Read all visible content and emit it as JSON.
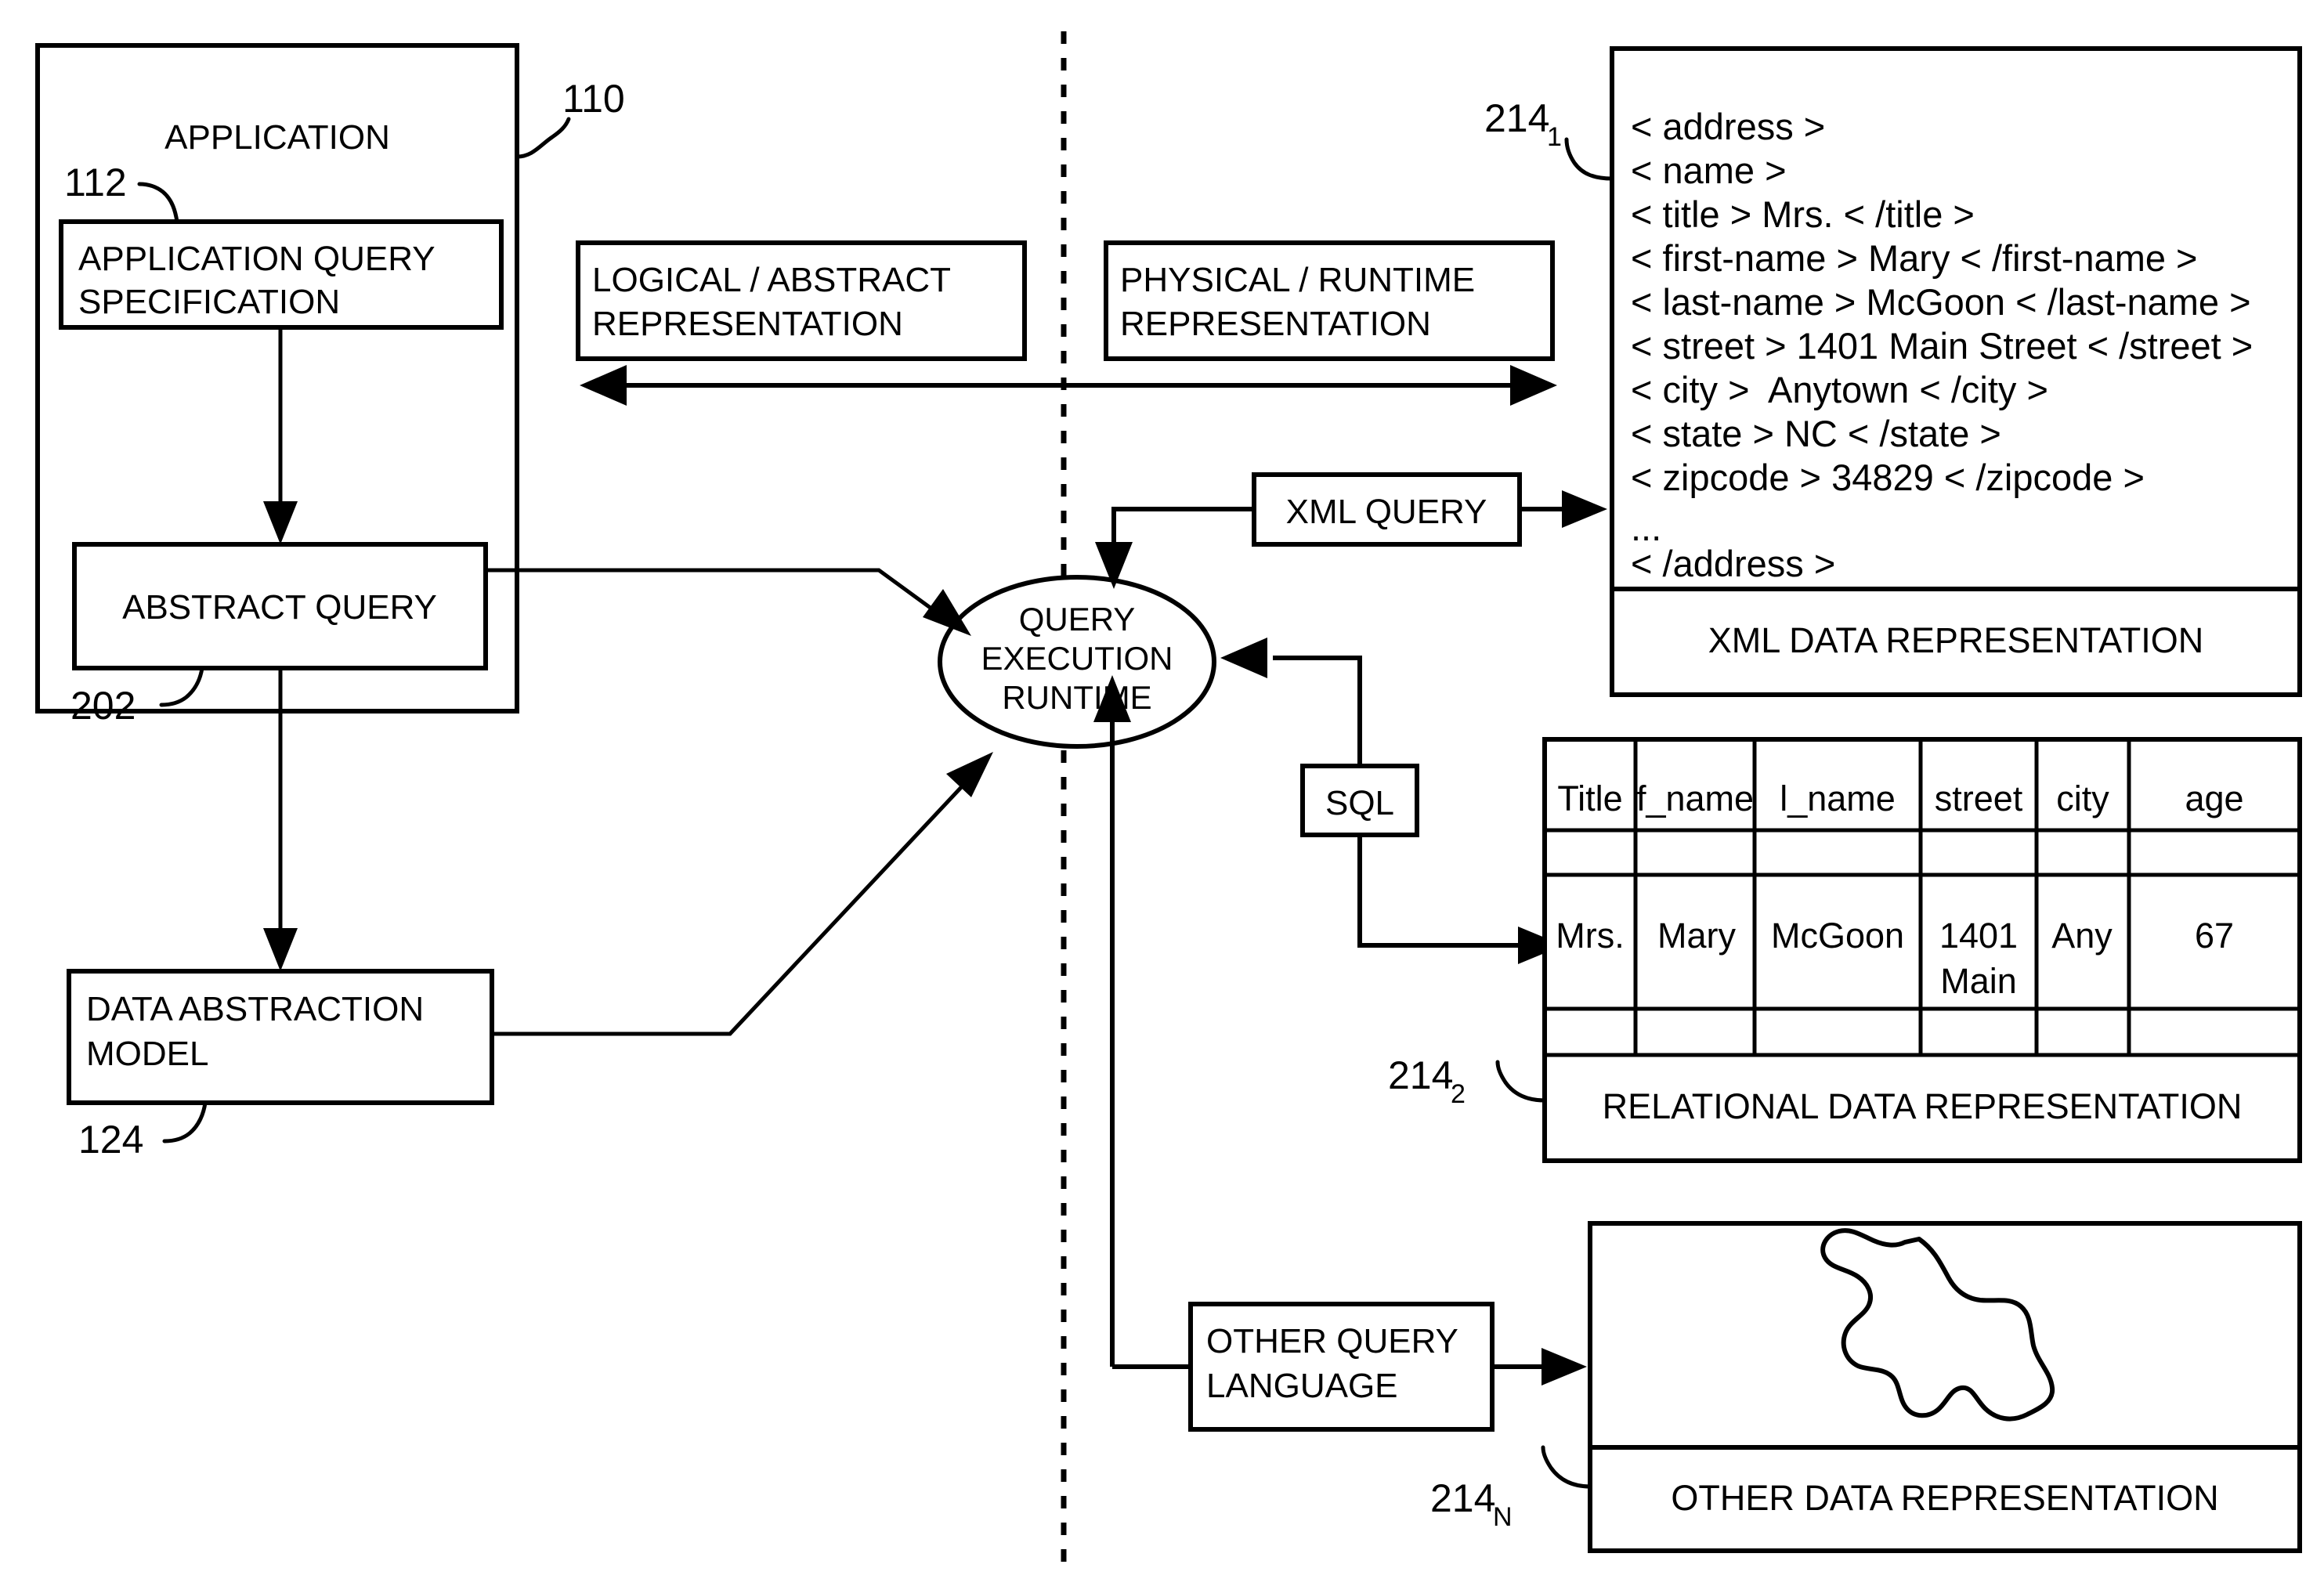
{
  "figure": {
    "type": "patent-block-diagram",
    "divider": "vertical-dashed-line"
  },
  "left_panel": {
    "application_label": "APPLICATION",
    "application_ref": "110",
    "query_spec_label": "APPLICATION QUERY\nSPECIFICATION",
    "query_spec_line1": "APPLICATION QUERY",
    "query_spec_line2": "SPECIFICATION",
    "query_spec_ref": "112",
    "abstract_query_label": "ABSTRACT QUERY",
    "abstract_query_ref": "202",
    "data_abstraction_line1": "DATA ABSTRACTION",
    "data_abstraction_line2": "MODEL",
    "data_abstraction_ref": "124"
  },
  "legend": {
    "logical_line1": "LOGICAL / ABSTRACT",
    "logical_line2": "REPRESENTATION",
    "physical_line1": "PHYSICAL / RUNTIME",
    "physical_line2": "REPRESENTATION"
  },
  "runtime": {
    "line1": "QUERY",
    "line2": "EXECUTION",
    "line3": "RUNTIME"
  },
  "query_languages": {
    "xml_query": "XML QUERY",
    "sql": "SQL",
    "other_query_line1": "OTHER QUERY",
    "other_query_line2": "LANGUAGE"
  },
  "xml_representation": {
    "ref": "214",
    "ref_sub": "1",
    "caption": "XML DATA REPRESENTATION",
    "lines": [
      "< address >",
      "< name >",
      "< title > Mrs. < /title >",
      "< first-name > Mary < /first-name >",
      "< last-name > McGoon < /last-name >",
      "< street > 1401 Main Street < /street >",
      "< city >  Anytown < /city >",
      "< state > NC < /state >",
      "< zipcode > 34829 < /zipcode >",
      "...",
      "< /address >"
    ]
  },
  "relational_representation": {
    "ref": "214",
    "ref_sub": "2",
    "caption": "RELATIONAL DATA REPRESENTATION",
    "columns": [
      "Title",
      "f_name",
      "l_name",
      "street",
      "city",
      "age"
    ],
    "rows": [
      [
        "",
        "",
        "",
        "",
        "",
        ""
      ],
      [
        "Mrs.",
        "Mary",
        "McGoon",
        "1401\nMain",
        "Any",
        "67"
      ],
      [
        "",
        "",
        "",
        "",
        "",
        ""
      ]
    ],
    "data_row": {
      "title": "Mrs.",
      "f_name": "Mary",
      "l_name": "McGoon",
      "street_line1": "1401",
      "street_line2": "Main",
      "city": "Any",
      "age": "67"
    }
  },
  "other_representation": {
    "ref": "214",
    "ref_sub": "N",
    "caption": "OTHER DATA REPRESENTATION",
    "shape": "amorphous-blob"
  },
  "colors": {
    "stroke": "#000000",
    "fill": "#ffffff"
  }
}
